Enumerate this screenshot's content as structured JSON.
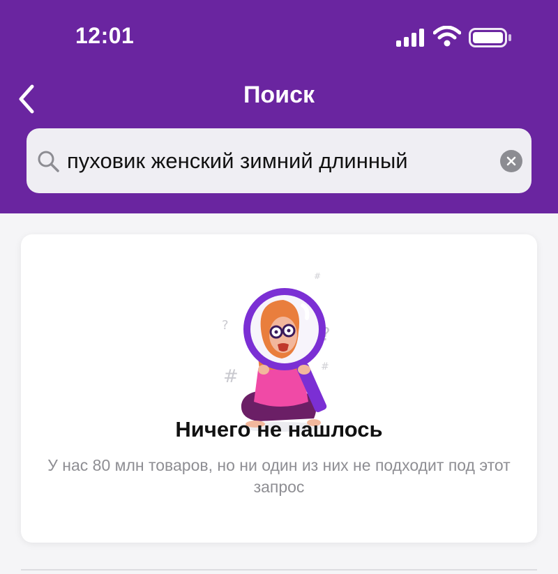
{
  "status_bar": {
    "time": "12:01",
    "icons": [
      "signal-icon",
      "wifi-icon",
      "battery-icon"
    ]
  },
  "header": {
    "title": "Поиск",
    "back_icon": "chevron-left-icon"
  },
  "search": {
    "value": "пуховик женский зимний длинный",
    "icon": "search-icon",
    "clear_icon": "clear-icon"
  },
  "empty_state": {
    "illustration": "woman-with-magnifier-illustration",
    "title": "Ничего не нашлось",
    "description": "У нас 80 млн товаров, но ни один из них не подходит под этот запрос"
  },
  "colors": {
    "header_bg": "#6a25a0",
    "accent_purple": "#7b2fd4",
    "search_bg": "#efeef3",
    "pink": "#f04aa6",
    "muted_text": "#8e8e93"
  }
}
